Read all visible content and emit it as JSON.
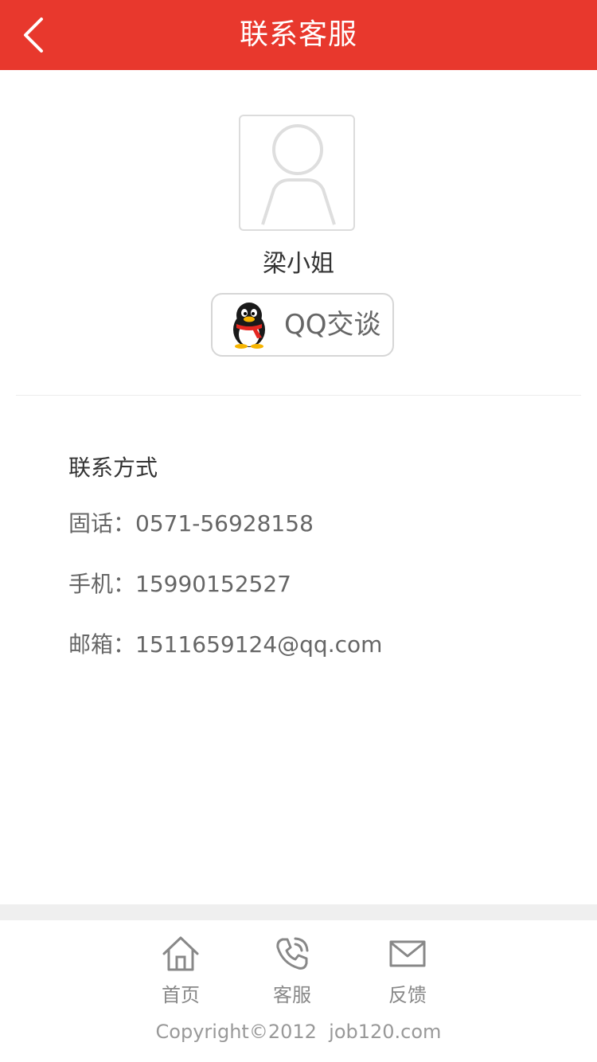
{
  "header": {
    "title": "联系客服",
    "back_icon": "chevron-left-icon",
    "bg_color": "#e8382d"
  },
  "service": {
    "avatar_icon": "user-placeholder-icon",
    "name": "梁小姐",
    "qq_button_label": "QQ交谈",
    "qq_icon": "qq-penguin-icon"
  },
  "contact": {
    "heading": "联系方式",
    "phone": "固话：0571-56928158",
    "mobile": "手机：15990152527",
    "email": "邮箱：1511659124@qq.com"
  },
  "footer": {
    "nav": [
      {
        "label": "首页",
        "icon": "home-icon"
      },
      {
        "label": "客服",
        "icon": "phone-icon"
      },
      {
        "label": "反馈",
        "icon": "mail-icon"
      }
    ],
    "copyright": "Copyright©2012  job120.com"
  }
}
